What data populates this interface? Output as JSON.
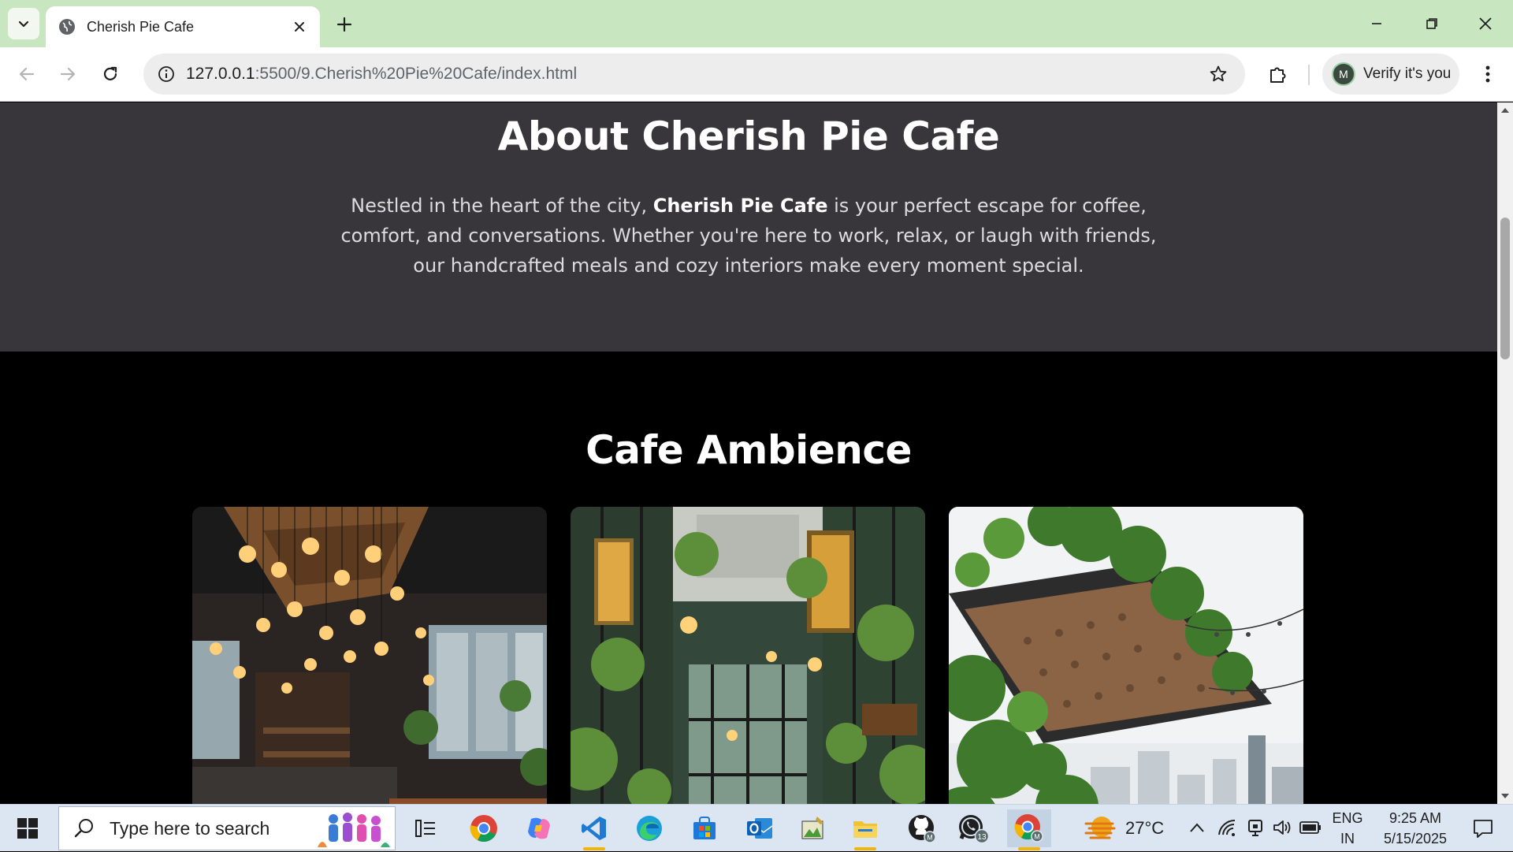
{
  "browser": {
    "tab_title": "Cherish Pie Cafe",
    "url_host": "127.0.0.1",
    "url_rest": ":5500/9.Cherish%20Pie%20Cafe/index.html",
    "profile_label": "Verify it's you",
    "profile_initial": "M",
    "theme_color": "#c8e6c0"
  },
  "page": {
    "about": {
      "heading": "About Cherish Pie Cafe",
      "text_before": "Nestled in the heart of the city, ",
      "text_bold": "Cherish Pie Cafe",
      "text_after": " is your perfect escape for coffee, comfort, and conversations. Whether you're here to work, relax, or laugh with friends, our handcrafted meals and cozy interiors make every moment special.",
      "bg_color": "#38353b"
    },
    "ambience": {
      "heading": "Cafe Ambience",
      "photos": [
        {
          "name": "cafe-interior-pendant-lights-photo"
        },
        {
          "name": "cafe-greenhouse-corridor-photo"
        },
        {
          "name": "cafe-rooftop-terrace-photo"
        }
      ]
    }
  },
  "taskbar": {
    "search_placeholder": "Type here to search",
    "temperature": "27°C",
    "lang_line1": "ENG",
    "lang_line2": "IN",
    "time": "9:25 AM",
    "date": "5/15/2025",
    "whatsapp_badge": "13",
    "icons": [
      "task-view-icon",
      "chrome-icon",
      "copilot-icon",
      "vscode-icon",
      "edge-icon",
      "ms-store-icon",
      "outlook-icon",
      "image-editor-icon",
      "file-explorer-icon",
      "github-desktop-icon",
      "whatsapp-icon",
      "chrome-profile-icon"
    ]
  }
}
